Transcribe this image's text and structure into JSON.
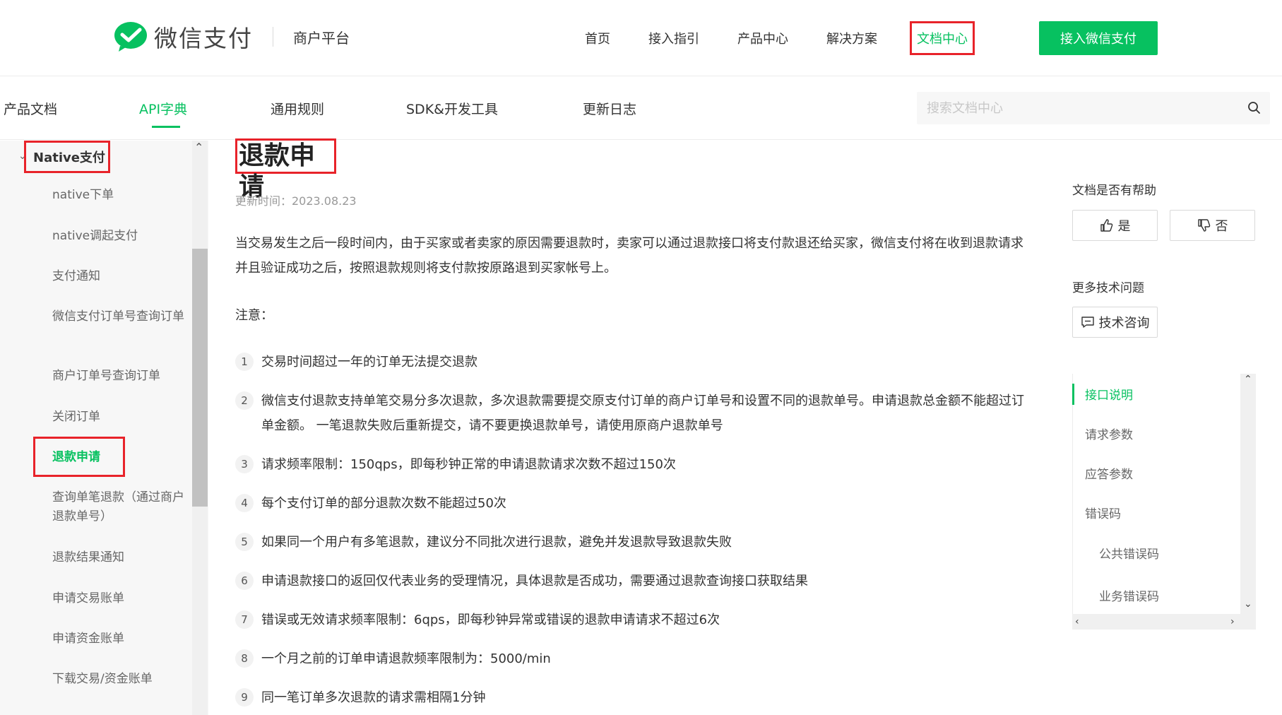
{
  "header": {
    "logo_text": "微信支付",
    "platform": "商户平台",
    "nav": [
      "首页",
      "接入指引",
      "产品中心",
      "解决方案",
      "文档中心"
    ],
    "join_button": "接入微信支付"
  },
  "subnav": {
    "tabs": [
      "产品文档",
      "API字典",
      "通用规则",
      "SDK&开发工具",
      "更新日志"
    ],
    "active_tab": "API字典",
    "search_placeholder": "搜索文档中心"
  },
  "sidebar": {
    "section": "Native支付",
    "items": [
      "native下单",
      "native调起支付",
      "支付通知",
      "微信支付订单号查询订单",
      "商户订单号查询订单",
      "关闭订单",
      "退款申请",
      "查询单笔退款（通过商户退款单号）",
      "退款结果通知",
      "申请交易账单",
      "申请资金账单",
      "下载交易/资金账单"
    ],
    "active_item": "退款申请"
  },
  "content": {
    "title": "退款申请",
    "update_time": "更新时间：2023.08.23",
    "intro": "当交易发生之后一段时间内，由于买家或者卖家的原因需要退款时，卖家可以通过退款接口将支付款退还给买家，微信支付将在收到退款请求并且验证成功之后，按照退款规则将支付款按原路退到买家帐号上。",
    "note_label": "注意：",
    "notes": [
      {
        "num": "1",
        "text": "交易时间超过一年的订单无法提交退款"
      },
      {
        "num": "2",
        "text": "微信支付退款支持单笔交易分多次退款，多次退款需要提交原支付订单的商户订单号和设置不同的退款单号。申请退款总金额不能超过订单金额。 一笔退款失败后重新提交，请不要更换退款单号，请使用原商户退款单号"
      },
      {
        "num": "3",
        "text": "请求频率限制：150qps，即每秒钟正常的申请退款请求次数不超过150次"
      },
      {
        "num": "4",
        "text": "每个支付订单的部分退款次数不能超过50次"
      },
      {
        "num": "5",
        "text": "如果同一个用户有多笔退款，建议分不同批次进行退款，避免并发退款导致退款失败"
      },
      {
        "num": "6",
        "text": "申请退款接口的返回仅代表业务的受理情况，具体退款是否成功，需要通过退款查询接口获取结果"
      },
      {
        "num": "7",
        "text": "错误或无效请求频率限制：6qps，即每秒钟异常或错误的退款申请请求不超过6次"
      },
      {
        "num": "8",
        "text": "一个月之前的订单申请退款频率限制为：5000/min"
      },
      {
        "num": "9",
        "text": "同一笔订单多次退款的请求需相隔1分钟"
      }
    ]
  },
  "right_panel": {
    "help_label": "文档是否有帮助",
    "yes": "是",
    "no": "否",
    "more_label": "更多技术问题",
    "consult": "技术咨询",
    "toc": [
      "接口说明",
      "请求参数",
      "应答参数",
      "错误码",
      "公共错误码",
      "业务错误码"
    ]
  },
  "colors": {
    "brand_green": "#07c160",
    "highlight_red": "#e8232a"
  }
}
